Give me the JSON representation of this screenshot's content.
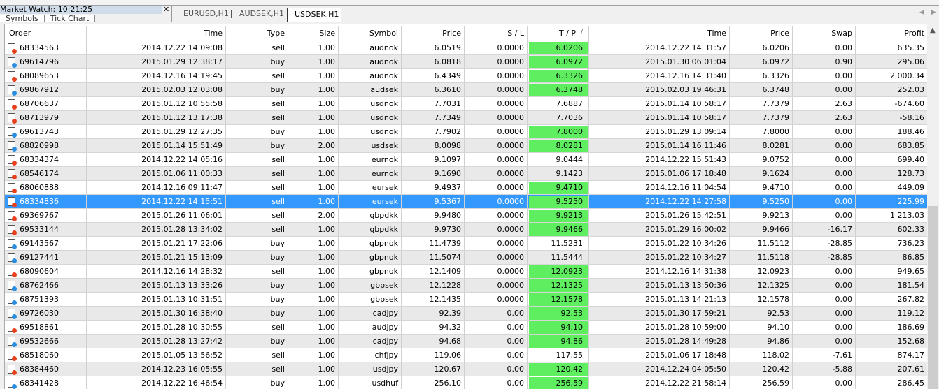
{
  "market_watch": {
    "title": "Market Watch: 10:21:25",
    "tabs": [
      "Symbols",
      "Tick Chart"
    ]
  },
  "chart_tabs": [
    "EURUSD,H1",
    "AUDSEK,H1",
    "USDSEK,H1"
  ],
  "columns": [
    "Order",
    "Time",
    "Type",
    "Size",
    "Symbol",
    "Price",
    "S / L",
    "T / P",
    "Time",
    "Price",
    "Swap",
    "Profit"
  ],
  "tp_sort_indicator": "/",
  "colors": {
    "tp_hit": "#5fee5f",
    "selected": "#3399ff",
    "sell_dot": "#e8401c",
    "buy_dot": "#2a8de0"
  },
  "selected_index": 11,
  "rows": [
    [
      "68334563",
      "2014.12.22 14:09:08",
      "sell",
      "1.00",
      "audnok",
      "6.0519",
      "0.0000",
      "6.0206",
      "2014.12.22 14:31:57",
      "6.0206",
      "0.00",
      "635.35",
      true
    ],
    [
      "69614796",
      "2015.01.29 12:38:17",
      "buy",
      "1.00",
      "audnok",
      "6.0818",
      "0.0000",
      "6.0972",
      "2015.01.30 06:01:04",
      "6.0972",
      "0.90",
      "295.06",
      true
    ],
    [
      "68089653",
      "2014.12.16 14:19:45",
      "sell",
      "1.00",
      "audnok",
      "6.4349",
      "0.0000",
      "6.3326",
      "2014.12.16 14:31:40",
      "6.3326",
      "0.00",
      "2 000.34",
      true
    ],
    [
      "69867912",
      "2015.02.03 12:03:08",
      "buy",
      "1.00",
      "audsek",
      "6.3610",
      "0.0000",
      "6.3748",
      "2015.02.03 19:46:31",
      "6.3748",
      "0.00",
      "252.03",
      true
    ],
    [
      "68706637",
      "2015.01.12 10:55:58",
      "sell",
      "1.00",
      "usdnok",
      "7.7031",
      "0.0000",
      "7.6887",
      "2015.01.14 10:58:17",
      "7.7379",
      "2.63",
      "-674.60",
      false
    ],
    [
      "68713979",
      "2015.01.12 13:17:38",
      "sell",
      "1.00",
      "usdnok",
      "7.7349",
      "0.0000",
      "7.7036",
      "2015.01.14 10:58:17",
      "7.7379",
      "2.63",
      "-58.16",
      false
    ],
    [
      "69613743",
      "2015.01.29 12:27:35",
      "buy",
      "1.00",
      "usdnok",
      "7.7902",
      "0.0000",
      "7.8000",
      "2015.01.29 13:09:14",
      "7.8000",
      "0.00",
      "188.46",
      true
    ],
    [
      "68820998",
      "2015.01.14 15:51:49",
      "buy",
      "2.00",
      "usdsek",
      "8.0098",
      "0.0000",
      "8.0281",
      "2015.01.14 16:11:46",
      "8.0281",
      "0.00",
      "683.85",
      true
    ],
    [
      "68334374",
      "2014.12.22 14:05:16",
      "sell",
      "1.00",
      "eurnok",
      "9.1097",
      "0.0000",
      "9.0444",
      "2014.12.22 15:51:43",
      "9.0752",
      "0.00",
      "699.40",
      false
    ],
    [
      "68546174",
      "2015.01.06 11:00:33",
      "sell",
      "1.00",
      "eurnok",
      "9.1690",
      "0.0000",
      "9.1423",
      "2015.01.06 17:18:48",
      "9.1624",
      "0.00",
      "128.73",
      false
    ],
    [
      "68060888",
      "2014.12.16 09:11:47",
      "sell",
      "1.00",
      "eursek",
      "9.4937",
      "0.0000",
      "9.4710",
      "2014.12.16 11:04:54",
      "9.4710",
      "0.00",
      "449.09",
      true
    ],
    [
      "68334836",
      "2014.12.22 14:15:51",
      "sell",
      "1.00",
      "eursek",
      "9.5367",
      "0.0000",
      "9.5250",
      "2014.12.22 14:27:58",
      "9.5250",
      "0.00",
      "225.99",
      true
    ],
    [
      "69369767",
      "2015.01.26 11:06:01",
      "sell",
      "2.00",
      "gbpdkk",
      "9.9480",
      "0.0000",
      "9.9213",
      "2015.01.26 15:42:51",
      "9.9213",
      "0.00",
      "1 213.03",
      true
    ],
    [
      "69533144",
      "2015.01.28 13:34:02",
      "sell",
      "1.00",
      "gbpdkk",
      "9.9730",
      "0.0000",
      "9.9466",
      "2015.01.29 16:00:02",
      "9.9466",
      "-16.17",
      "602.33",
      true
    ],
    [
      "69143567",
      "2015.01.21 17:22:06",
      "buy",
      "1.00",
      "gbpnok",
      "11.4739",
      "0.0000",
      "11.5231",
      "2015.01.22 10:34:26",
      "11.5112",
      "-28.85",
      "736.23",
      false
    ],
    [
      "69127441",
      "2015.01.21 15:13:09",
      "buy",
      "1.00",
      "gbpnok",
      "11.5074",
      "0.0000",
      "11.5444",
      "2015.01.22 10:34:27",
      "11.5118",
      "-28.85",
      "86.85",
      false
    ],
    [
      "68090604",
      "2014.12.16 14:28:32",
      "sell",
      "1.00",
      "gbpnok",
      "12.1409",
      "0.0000",
      "12.0923",
      "2014.12.16 14:31:38",
      "12.0923",
      "0.00",
      "949.65",
      true
    ],
    [
      "68762466",
      "2015.01.13 13:33:26",
      "buy",
      "1.00",
      "gbpsek",
      "12.1228",
      "0.0000",
      "12.1325",
      "2015.01.13 13:50:36",
      "12.1325",
      "0.00",
      "181.54",
      true
    ],
    [
      "68751393",
      "2015.01.13 10:31:51",
      "buy",
      "1.00",
      "gbpsek",
      "12.1435",
      "0.0000",
      "12.1578",
      "2015.01.13 14:21:13",
      "12.1578",
      "0.00",
      "267.82",
      true
    ],
    [
      "69726030",
      "2015.01.30 16:38:40",
      "buy",
      "1.00",
      "cadjpy",
      "92.39",
      "0.00",
      "92.53",
      "2015.01.30 17:59:21",
      "92.53",
      "0.00",
      "119.12",
      true
    ],
    [
      "69518861",
      "2015.01.28 10:30:55",
      "sell",
      "1.00",
      "audjpy",
      "94.32",
      "0.00",
      "94.10",
      "2015.01.28 10:59:00",
      "94.10",
      "0.00",
      "186.69",
      true
    ],
    [
      "69532666",
      "2015.01.28 13:27:42",
      "buy",
      "1.00",
      "cadjpy",
      "94.68",
      "0.00",
      "94.86",
      "2015.01.28 14:49:28",
      "94.86",
      "0.00",
      "152.68",
      true
    ],
    [
      "68518060",
      "2015.01.05 13:56:52",
      "sell",
      "1.00",
      "chfjpy",
      "119.06",
      "0.00",
      "117.55",
      "2015.01.06 17:18:48",
      "118.02",
      "-7.61",
      "874.17",
      false
    ],
    [
      "68384460",
      "2014.12.23 16:05:55",
      "sell",
      "1.00",
      "usdjpy",
      "120.67",
      "0.00",
      "120.42",
      "2014.12.24 04:05:50",
      "120.42",
      "-5.88",
      "207.61",
      true
    ],
    [
      "68341428",
      "2014.12.22 16:46:54",
      "buy",
      "1.00",
      "usdhuf",
      "256.10",
      "0.00",
      "256.59",
      "2014.12.22 21:58:14",
      "256.59",
      "0.00",
      "286.45",
      true
    ]
  ]
}
